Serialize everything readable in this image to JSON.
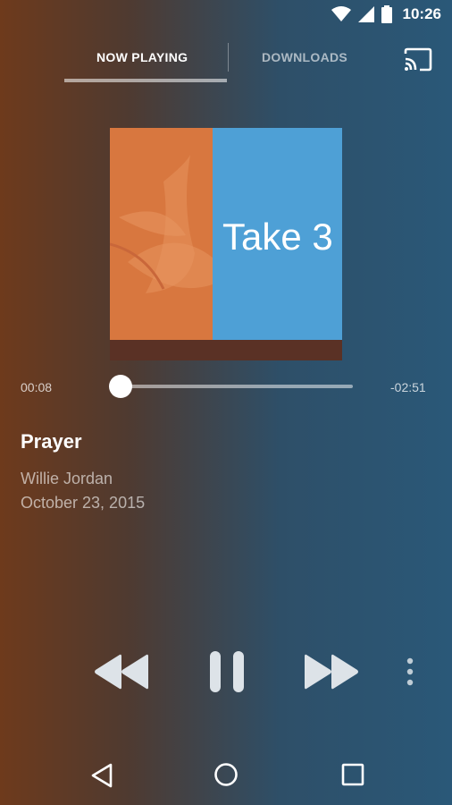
{
  "status_bar": {
    "time": "10:26",
    "icons": [
      "wifi-icon",
      "signal-icon",
      "battery-icon"
    ]
  },
  "tabs": [
    {
      "label": "NOW PLAYING",
      "active": true
    },
    {
      "label": "DOWNLOADS",
      "active": false
    }
  ],
  "toolbar": {
    "cast_icon": "cast-icon"
  },
  "album_art": {
    "title": "Take 3",
    "colors": {
      "left": "#d8773f",
      "right": "#4ea0d6",
      "bottom": "#5a3125"
    }
  },
  "player": {
    "elapsed": "00:08",
    "remaining": "-02:51",
    "progress": 0.04
  },
  "track": {
    "title": "Prayer",
    "artist": "Willie Jordan",
    "date": "October 23, 2015"
  },
  "controls": [
    "rewind-icon",
    "pause-icon",
    "fast-forward-icon",
    "more-vert-icon"
  ],
  "nav_bar": [
    "back-icon",
    "home-icon",
    "recents-icon"
  ]
}
